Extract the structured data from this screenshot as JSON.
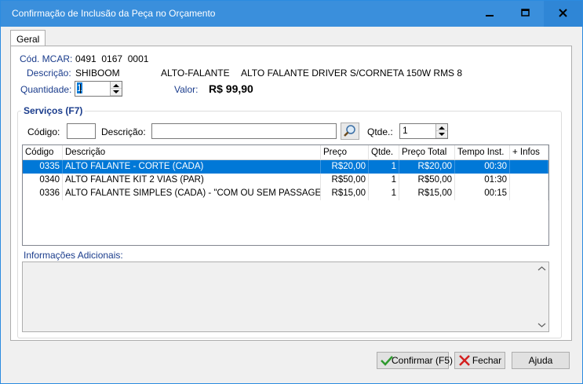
{
  "window": {
    "title": "Confirmação de Inclusão da Peça no Orçamento",
    "controls": {
      "minimize": "minimize-icon",
      "maximize": "maximize-icon",
      "close": "close-icon"
    }
  },
  "tabs": [
    {
      "label": "Geral"
    }
  ],
  "part": {
    "cod_mcar_label": "Cód. MCAR:",
    "cod_mcar_value": "0491  0167  0001",
    "descricao_label": "Descrição:",
    "brand": "SHIBOOM",
    "category": "ALTO-FALANTE",
    "description": "ALTO FALANTE DRIVER S/CORNETA 150W RMS 8",
    "quantidade_label": "Quantidade:",
    "quantidade_value": "1",
    "valor_label": "Valor:",
    "valor_value": "R$ 99,90"
  },
  "services": {
    "group_title": "Serviços (F7)",
    "codigo_label": "Código:",
    "codigo_value": "",
    "descricao_label": "Descrição:",
    "descricao_value": "",
    "qtde_label": "Qtde.:",
    "qtde_value": "1",
    "columns": [
      "Código",
      "Descrição",
      "Preço",
      "Qtde.",
      "Preço Total",
      "Tempo Inst.",
      "+ Infos"
    ],
    "rows": [
      {
        "codigo": "0335",
        "descricao": "ALTO FALANTE - CORTE (CADA)",
        "preco": "R$20,00",
        "qtde": "1",
        "total": "R$20,00",
        "tempo": "00:30",
        "infos": "",
        "selected": true
      },
      {
        "codigo": "0340",
        "descricao": "ALTO FALANTE KIT 2 VIAS (PAR)",
        "preco": "R$50,00",
        "qtde": "1",
        "total": "R$50,00",
        "tempo": "01:30",
        "infos": "",
        "selected": false
      },
      {
        "codigo": "0336",
        "descricao": "ALTO FALANTE SIMPLES (CADA) - \"COM OU SEM PASSAGEM...",
        "preco": "R$15,00",
        "qtde": "1",
        "total": "R$15,00",
        "tempo": "00:15",
        "infos": "",
        "selected": false
      }
    ]
  },
  "info": {
    "label": "Informações Adicionais:",
    "value": ""
  },
  "buttons": {
    "confirm": "Confirmar (F5)",
    "close": "Fechar",
    "help": "Ajuda"
  },
  "colors": {
    "titlebar": "#3a8fdc",
    "selection": "#0078d7",
    "label_blue": "#1a3c8c"
  }
}
